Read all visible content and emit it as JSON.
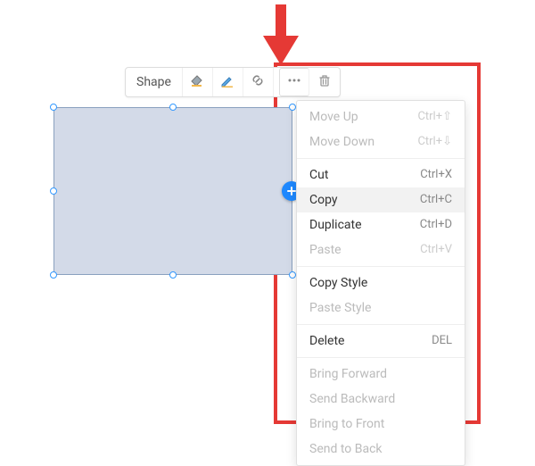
{
  "toolbar": {
    "shape_label": "Shape"
  },
  "menu": {
    "items": [
      {
        "label": "Move Up",
        "shortcut": "Ctrl+⇧",
        "enabled": false
      },
      {
        "label": "Move Down",
        "shortcut": "Ctrl+⇩",
        "enabled": false
      },
      {
        "sep": true
      },
      {
        "label": "Cut",
        "shortcut": "Ctrl+X",
        "enabled": true
      },
      {
        "label": "Copy",
        "shortcut": "Ctrl+C",
        "enabled": true,
        "hovered": true
      },
      {
        "label": "Duplicate",
        "shortcut": "Ctrl+D",
        "enabled": true
      },
      {
        "label": "Paste",
        "shortcut": "Ctrl+V",
        "enabled": false
      },
      {
        "sep": true
      },
      {
        "label": "Copy Style",
        "shortcut": "",
        "enabled": true
      },
      {
        "label": "Paste Style",
        "shortcut": "",
        "enabled": false
      },
      {
        "sep": true
      },
      {
        "label": "Delete",
        "shortcut": "DEL",
        "enabled": true
      },
      {
        "sep": true
      },
      {
        "label": "Bring Forward",
        "shortcut": "",
        "enabled": false
      },
      {
        "label": "Send Backward",
        "shortcut": "",
        "enabled": false
      },
      {
        "label": "Bring to Front",
        "shortcut": "",
        "enabled": false
      },
      {
        "label": "Send to Back",
        "shortcut": "",
        "enabled": false
      }
    ]
  },
  "colors": {
    "accent_red": "#e53935",
    "shape_fill": "#d3dae8",
    "handle_blue": "#3399ff",
    "add_blue": "#1e88ff"
  }
}
